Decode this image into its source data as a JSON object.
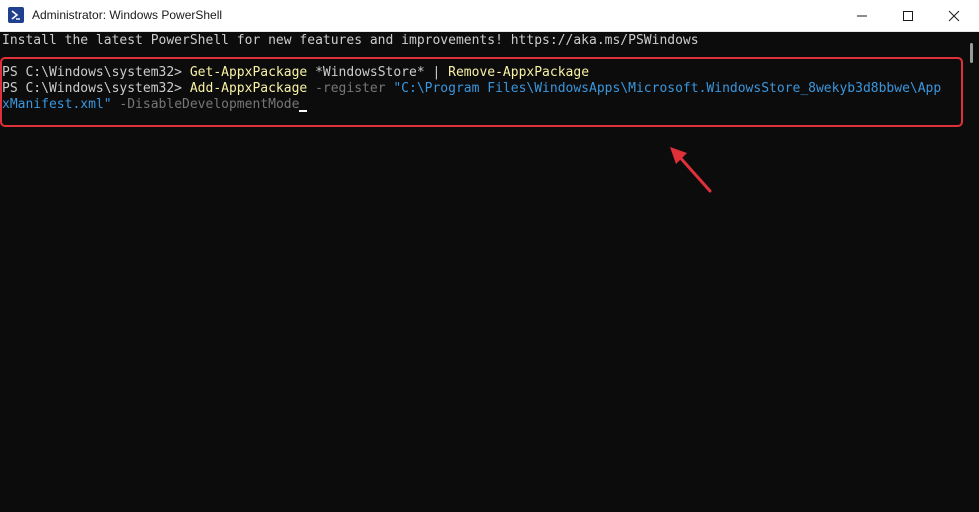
{
  "window": {
    "title": "Administrator: Windows PowerShell",
    "app_icon": "powershell-icon",
    "controls": [
      "minimize-icon",
      "maximize-icon",
      "close-icon"
    ]
  },
  "terminal": {
    "banner": "Install the latest PowerShell for new features and improvements! https://aka.ms/PSWindows",
    "line1": {
      "prompt": "PS C:\\Windows\\system32> ",
      "command": "Get-AppxPackage",
      "argument": " *WindowsStore* | ",
      "pipe_command": "Remove-AppxPackage"
    },
    "line2": {
      "prompt": "PS C:\\Windows\\system32> ",
      "command": "Add-AppxPackage",
      "parameter": " -register ",
      "path_part1": "\"C:\\Program Files\\WindowsApps\\Microsoft.WindowsStore_8wekyb3d8bbwe\\App",
      "path_part2": "xManifest.xml\"",
      "switch": " -DisableDevelopmentMode"
    }
  },
  "colors": {
    "background": "#0c0c0c",
    "command": "#f9f1a5",
    "string": "#3a96dd",
    "parameter": "#767676",
    "highlight": "#e0303a"
  }
}
